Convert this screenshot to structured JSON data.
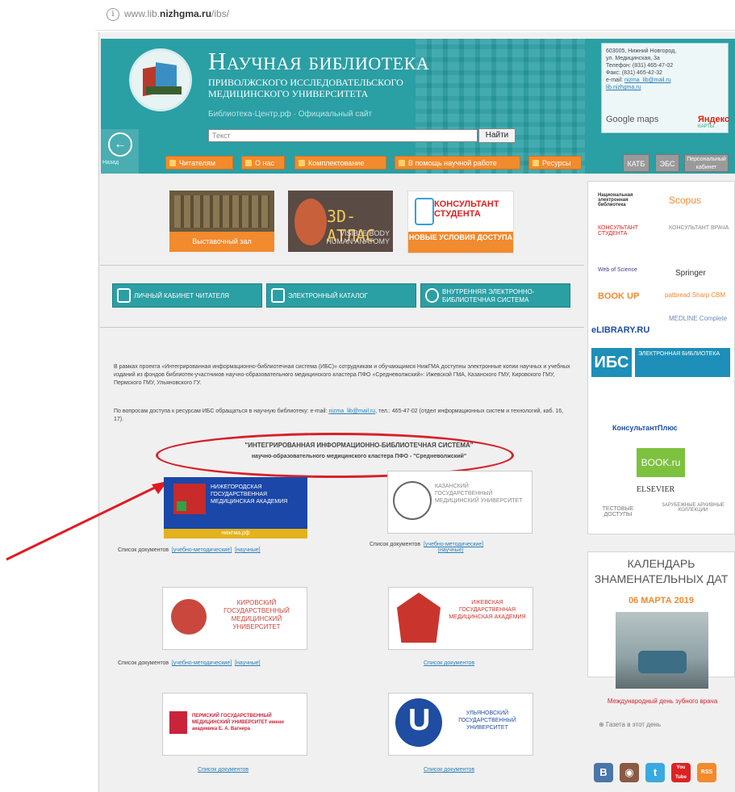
{
  "browser": {
    "url_prefix": "www.lib.",
    "url_domain": "nizhgma.ru",
    "url_suffix": "/ibs/"
  },
  "header": {
    "title": "Научная библиотека",
    "subtitle_line1": "ПРИВОЛЖСКОГО ИССЛЕДОВАТЕЛЬСКОГО",
    "subtitle_line2": "МЕДИЦИНСКОГО УНИВЕРСИТЕТА",
    "links": "Библиотека-Центр.рф   ·   Официальный сайт",
    "search_placeholder": "Текст",
    "search_button": "Найти",
    "back_label": "Назад",
    "contact_lines": [
      "603005, Нижний Новгород,",
      "ул. Медицинская, 3а",
      "Телефон: (831) 465-47-02",
      "Факс: (831) 465-42-32",
      "e-mail: "
    ],
    "contact_email": "nizma_lib@mail.ru",
    "contact_site": "lib.nizhgma.ru",
    "maps_label": "Google maps",
    "yandex_label": "Яндекс",
    "yandex_sub": "КАРТЫ"
  },
  "nav": [
    "Читателям",
    "О нас",
    "Комплектование",
    "В помощь научной работе",
    "Ресурсы"
  ],
  "nav_grey": [
    "КАТБ",
    "ЭБС",
    "Персональный кабинет"
  ],
  "banners": {
    "b1_label": "Выставочный зал",
    "b2_title": "3D-АТЛАС",
    "b2_sub": "VISIBLE BODY HUMAN ANATOMY",
    "b3_title": "КОНСУЛЬТАНТ СТУДЕНТА",
    "b3_sub": "НОВЫЕ УСЛОВИЯ ДОСТУПА"
  },
  "teal_buttons": [
    "ЛИЧНЫЙ КАБИНЕТ ЧИТАТЕЛЯ",
    "ЭЛЕКТРОННЫЙ КАТАЛОГ",
    "ВНУТРЕННЯЯ ЭЛЕКТРОННО-БИБЛИОТЕЧНАЯ СИСТЕМА"
  ],
  "main": {
    "para1": "В рамках проекта «Интегрированная информационно-библиотечная система (ИБС)» сотрудникам и обучающимся НижГМА доступны электронные копии научных и учебных изданий из фондов библиотек-участников научно-образовательного медицинского кластера ПФО «Средневолжский»: Ижевской ГМА, Казанского ГМУ, Кировского ГМУ, Пермского ГМУ, Ульяновского ГУ.",
    "para2_a": "По вопросам доступа к ресурсам ИБС обращаться в научную библиотеку: e-mail: ",
    "para2_email": "nizma_lib@mail.ru",
    "para2_b": ", тел.: 465-47-02 (отдел информационных систем и технологий, каб. 16, 17).",
    "ig_title": "\"ИНТЕГРИРОВАННАЯ ИНФОРМАЦИОННО-БИБЛИОТЕЧНАЯ СИСТЕМА\"",
    "ig_sub": "научно-образовательного медицинского кластера ПФО - \"Средневолжский\""
  },
  "unis": {
    "u1": "НИЖЕГОРОДСКАЯ ГОСУДАРСТВЕННАЯ МЕДИЦИНСКАЯ АКАДЕМИЯ",
    "u1_site": "нижгма.рф",
    "u2": "КАЗАНСКИЙ ГОСУДАРСТВЕННЫЙ МЕДИЦИНСКИЙ УНИВЕРСИТЕТ",
    "u3": "КИРОВСКИЙ ГОСУДАРСТВЕННЫЙ МЕДИЦИНСКИЙ УНИВЕРСИТЕТ",
    "u4": "ИЖЕВСКАЯ ГОСУДАРСТВЕННАЯ МЕДИЦИНСКАЯ АКАДЕМИЯ",
    "u5": "ПЕРМСКИЙ ГОСУДАРСТВЕННЫЙ МЕДИЦИНСКИЙ УНИВЕРСИТЕТ имени академика Е. А. Вагнера",
    "u6": "УЛЬЯНОВСКИЙ ГОСУДАРСТВЕННЫЙ УНИВЕРСИТЕТ"
  },
  "doc": {
    "label": "Список документов",
    "edu": "[учебно-методические]",
    "sci": "[научные]",
    "list": "Список документов"
  },
  "sidebar": {
    "logos": [
      "Национальная электронная библиотека",
      "Scopus",
      "КОНСУЛЬТАНТ СТУДЕНТА",
      "КОНСУЛЬТАНТ ВРАЧА",
      "Web of Science",
      "Springer",
      "BOOK UP",
      "patbread Sharp CBM",
      "eLIBRARY.RU",
      "MEDLINE Complete",
      "ИБС",
      "ЭЛЕКТРОННАЯ БИБЛИОТЕКА",
      "КонсультантПлюс",
      "BOOK.ru",
      "ELSEVIER",
      "ТЕСТОВЫЕ ДОСТУПЫ",
      "ЗАРУБЕЖНЫЕ АРХИВНЫЕ КОЛЛЕКЦИИ"
    ],
    "calendar_title": "КАЛЕНДАРЬ ЗНАМЕНАТЕЛЬНЫХ ДАТ",
    "calendar_date": "06 МАРТА 2019",
    "calendar_desc": "Международный день зубного врача",
    "calendar_day": "Газета в этот день"
  },
  "social": [
    "В",
    "◉",
    "t",
    "You Tube",
    "RSS"
  ]
}
